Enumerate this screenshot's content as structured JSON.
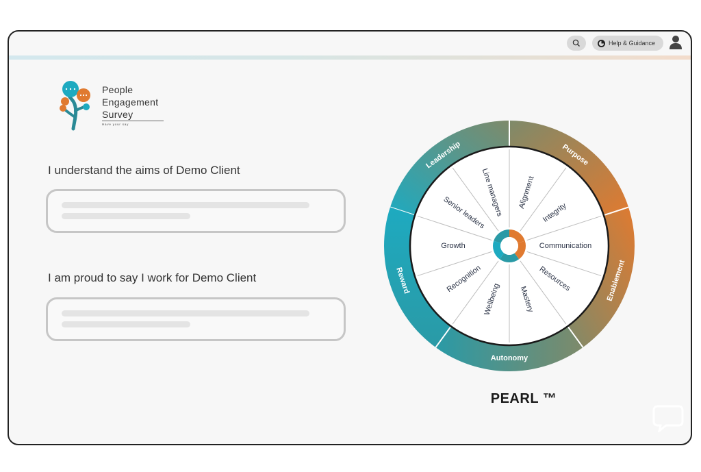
{
  "header": {
    "help_label": "Help & Guidance"
  },
  "logo": {
    "line1": "People",
    "line2": "Engagement",
    "line3": "Survey",
    "tagline": "Have your say"
  },
  "questions": [
    {
      "text": "I understand the aims of Demo Client"
    },
    {
      "text": "I am proud to say I work for Demo Client"
    }
  ],
  "wheel": {
    "title": "PEARL ™",
    "outer_segments": [
      "Leadership",
      "Purpose",
      "Enablement",
      "Autonomy",
      "Reward"
    ],
    "inner_segments": [
      "Line managers",
      "Alignment",
      "Integrity",
      "Communication",
      "Resources",
      "Mastery",
      "Wellbeing",
      "Recognition",
      "Growth",
      "Senior leaders"
    ],
    "colors": {
      "teal": "#2a9aa6",
      "orange": "#e07a30",
      "cyan": "#1eaac0",
      "olive": "#7e8a6a",
      "dark": "#1a1a1a"
    }
  },
  "icons": {
    "search": "search-icon",
    "help": "help-circle-icon",
    "user": "user-icon",
    "chat": "chat-bubble-icon"
  }
}
